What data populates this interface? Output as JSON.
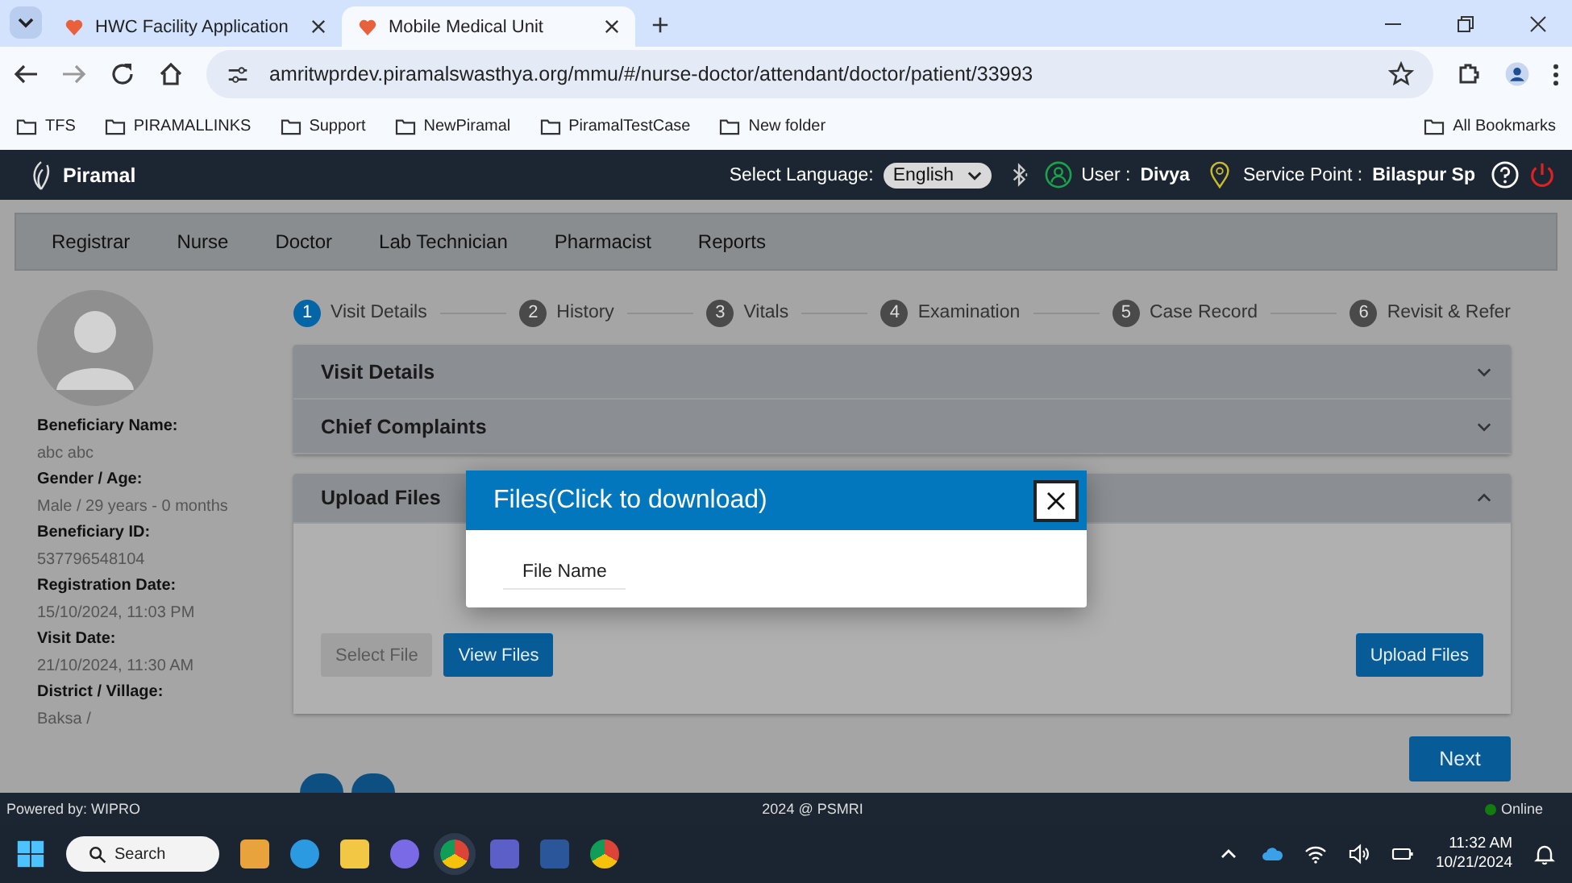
{
  "browser": {
    "tabs": [
      {
        "title": "HWC Facility Application",
        "selected": false
      },
      {
        "title": "Mobile Medical Unit",
        "selected": true
      }
    ],
    "url": "amritwprdev.piramalswasthya.org/mmu/#/nurse-doctor/attendant/doctor/patient/33993",
    "bookmarks": [
      "TFS",
      "PIRAMALLINKS",
      "Support",
      "NewPiramal",
      "PiramalTestCase",
      "New folder"
    ],
    "all_bookmarks": "All Bookmarks"
  },
  "header": {
    "brand": "Piramal",
    "language_label": "Select Language:",
    "language": "English",
    "user_label": "User :",
    "user_name": "Divya",
    "service_point_label": "Service Point :",
    "service_point": "Bilaspur Sp"
  },
  "nav": [
    "Registrar",
    "Nurse",
    "Doctor",
    "Lab Technician",
    "Pharmacist",
    "Reports"
  ],
  "beneficiary": [
    {
      "label": "Beneficiary Name:",
      "value": "abc abc"
    },
    {
      "label": "Gender / Age:",
      "value": "Male / 29 years - 0 months"
    },
    {
      "label": "Beneficiary ID:",
      "value": "537796548104"
    },
    {
      "label": "Registration Date:",
      "value": "15/10/2024, 11:03 PM"
    },
    {
      "label": "Visit Date:",
      "value": "21/10/2024, 11:30 AM"
    },
    {
      "label": "District / Village:",
      "value": "Baksa /"
    }
  ],
  "steps": [
    {
      "number": "1",
      "label": "Visit Details",
      "selected": true
    },
    {
      "number": "2",
      "label": "History",
      "selected": false
    },
    {
      "number": "3",
      "label": "Vitals",
      "selected": false
    },
    {
      "number": "4",
      "label": "Examination",
      "selected": false
    },
    {
      "number": "5",
      "label": "Case Record",
      "selected": false
    },
    {
      "number": "6",
      "label": "Revisit & Refer",
      "selected": false
    }
  ],
  "panels": [
    {
      "title": "Visit Details",
      "expanded": false
    },
    {
      "title": "Chief Complaints",
      "expanded": false
    }
  ],
  "upload": {
    "title": "Upload Files",
    "expanded": true,
    "select_file": {
      "label": "Select File",
      "disabled": true
    },
    "view_files": "View Files",
    "upload_files": "Upload Files"
  },
  "next": "Next",
  "modal": {
    "title": "Files(Click to download)",
    "column": "File Name"
  },
  "footer": {
    "powered": "Powered by: WIPRO",
    "copyright": "2024 @ PSMRI",
    "status": "Online"
  },
  "taskbar": {
    "search": "Search",
    "time": "11:32 AM",
    "date": "10/21/2024"
  }
}
